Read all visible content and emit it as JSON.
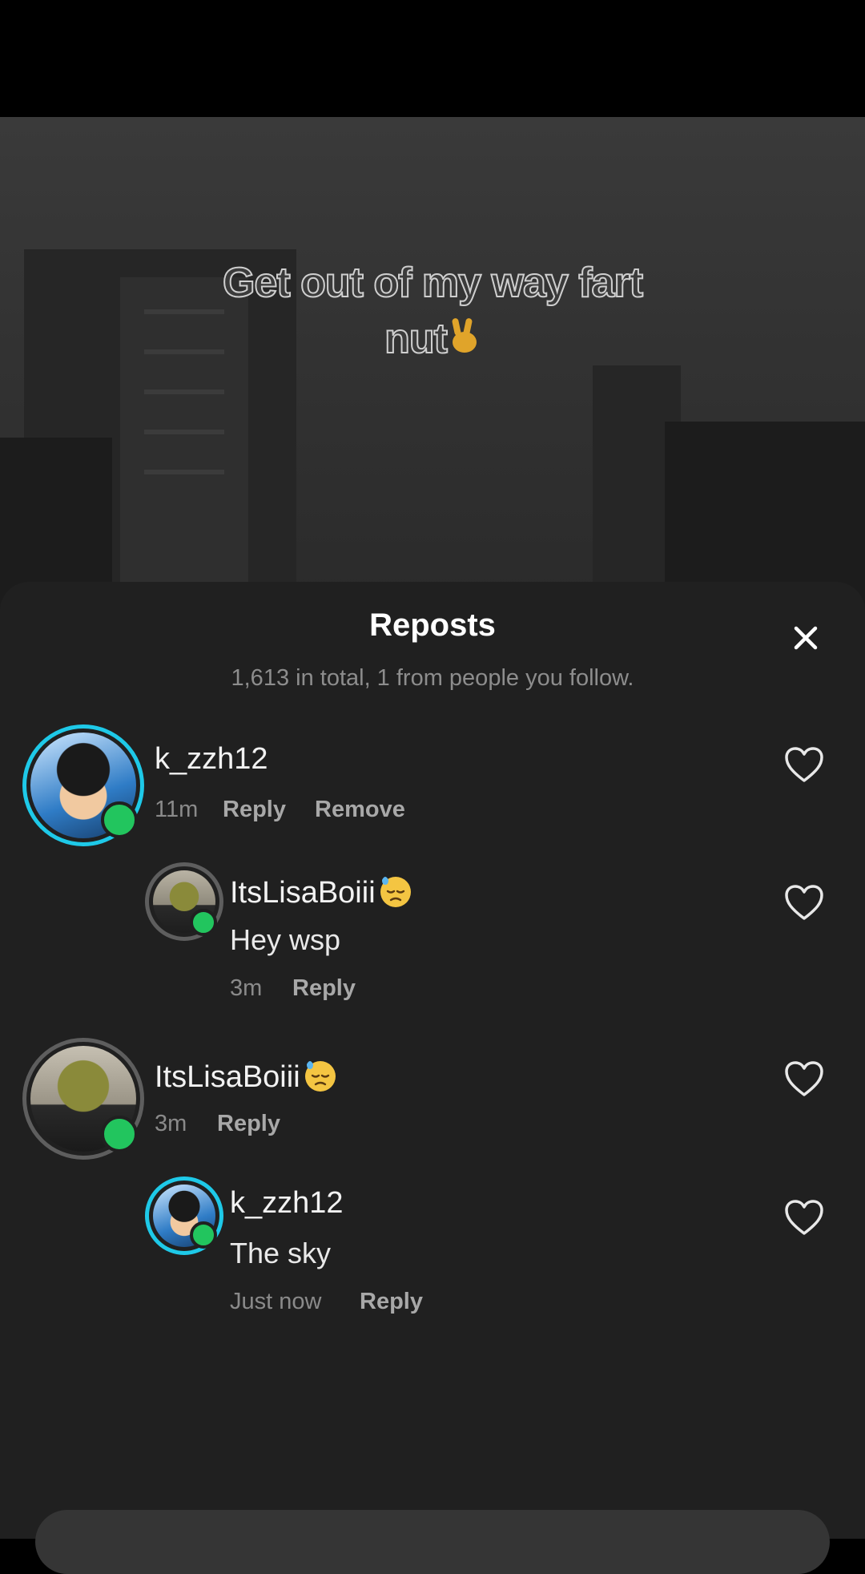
{
  "video": {
    "caption_line1": "Get out of my way fart",
    "caption_line2": "nut"
  },
  "sheet": {
    "title": "Reposts",
    "subtitle": "1,613 in total, 1 from people you follow."
  },
  "comments": [
    {
      "username": "k_zzh12",
      "time": "11m",
      "reply_label": "Reply",
      "remove_label": "Remove",
      "replies": [
        {
          "username": "ItsLisaBoiii",
          "text": "Hey wsp",
          "time": "3m",
          "reply_label": "Reply"
        }
      ]
    },
    {
      "username": "ItsLisaBoiii",
      "time": "3m",
      "reply_label": "Reply",
      "replies": [
        {
          "username": "k_zzh12",
          "text": "The sky",
          "time": "Just now",
          "reply_label": "Reply"
        }
      ]
    }
  ],
  "colors": {
    "sheet_bg": "#202020",
    "online": "#22c55e",
    "avatar_ring_teal": "#1ec9e8",
    "avatar_ring_grey": "#5e5e5e"
  },
  "icons": [
    "close-icon",
    "heart-icon",
    "victory-hand-emoji",
    "downcast-sweat-emoji"
  ]
}
